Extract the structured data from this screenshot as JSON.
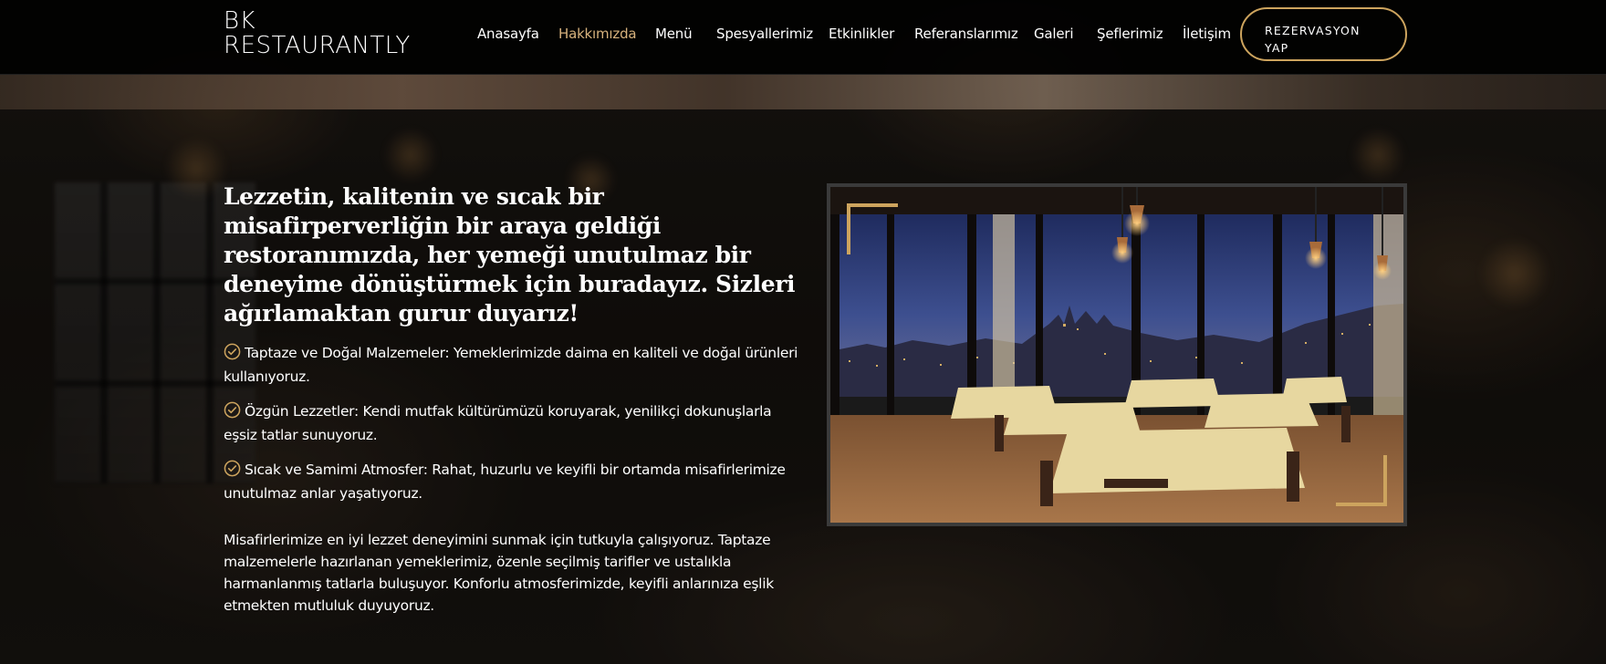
{
  "brand": {
    "line1": "BK",
    "line2": "RESTAURANTLY"
  },
  "nav": {
    "items": [
      {
        "label": "Anasayfa",
        "active": false
      },
      {
        "label": "Hakkımızda",
        "active": true
      },
      {
        "label": "Menü",
        "active": false
      },
      {
        "label": "Spesyallerimiz",
        "active": false
      },
      {
        "label": "Etkinlikler",
        "active": false
      },
      {
        "label": "Referanslarımız",
        "active": false
      },
      {
        "label": "Galeri",
        "active": false
      },
      {
        "label": "Şeflerimiz",
        "active": false
      },
      {
        "label": "İletişim",
        "active": false
      }
    ],
    "cta_line1": "REZERVASYON",
    "cta_line2": "YAP"
  },
  "about": {
    "headline": "Lezzetin, kalitenin ve sıcak bir misafirperverliğin bir araya geldiği restoranımızda, her yemeği unutulmaz bir deneyime dönüştürmek için buradayız. Sizleri ağırlamaktan gurur duyarız!",
    "features": [
      "Taptaze ve Doğal Malzemeler: Yemeklerimizde daima en kaliteli ve doğal ürünleri kullanıyoruz.",
      "Özgün Lezzetler: Kendi mutfak kültürümüzü koruyarak, yenilikçi dokunuşlarla eşsiz tatlar sunuyoruz.",
      "Sıcak ve Samimi Atmosfer: Rahat, huzurlu ve keyifli bir ortamda misafirlerimize unutulmaz anlar yaşatıyoruz."
    ],
    "paragraph": "Misafirlerimize en iyi lezzet deneyimini sunmak için tutkuyla çalışıyoruz. Taptaze malzemelerle hazırlanan yemeklerimiz, özenle seçilmiş tarifler ve ustalıkla harmanlanmış tatlarla buluşuyor. Konforlu atmosferimizde, keyifli anlarınıza eşlik etmekten mutluluk duyuyoruz."
  },
  "colors": {
    "accent": "#cda45e",
    "active_nav": "#d7b27d",
    "header_bg": "#000000"
  },
  "icons": {
    "feature": "check-circle-icon"
  }
}
